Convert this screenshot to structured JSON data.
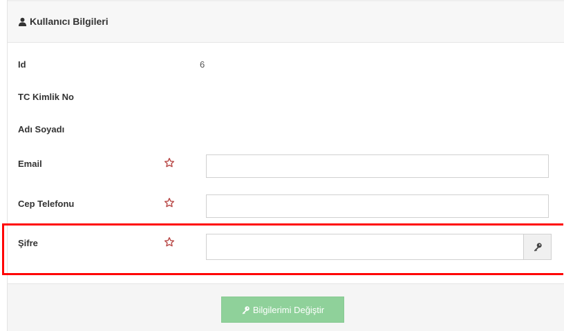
{
  "header": {
    "title": "Kullanıcı Bilgileri",
    "icon": "user-icon"
  },
  "fields": {
    "id": {
      "label": "Id",
      "value": "6"
    },
    "tc": {
      "label": "TC Kimlik No",
      "value": ""
    },
    "name": {
      "label": "Adı Soyadı",
      "value": ""
    },
    "email": {
      "label": "Email",
      "value": "",
      "required_icon": "star-icon"
    },
    "phone": {
      "label": "Cep Telefonu",
      "value": "",
      "required_icon": "star-icon"
    },
    "password": {
      "label": "Şifre",
      "value": "",
      "required_icon": "star-icon",
      "addon_icon": "key-icon"
    }
  },
  "footer": {
    "submit_label": "Bilgilerimi Değiştir",
    "submit_icon": "key-icon",
    "submit_color": "#8fd19a"
  },
  "colors": {
    "accent": "#8fd19a",
    "required": "#b94a48",
    "highlight": "#ff0000"
  }
}
